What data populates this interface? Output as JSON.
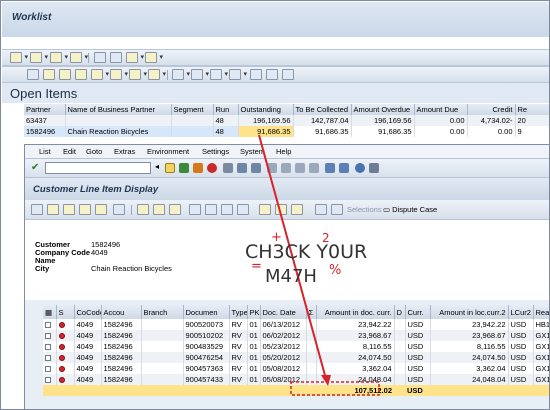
{
  "worklist": {
    "title": "Worklist"
  },
  "open_items": {
    "title": "Open Items",
    "columns": [
      "Partner",
      "Name of Business Partner",
      "Segment",
      "Run",
      "Outstanding",
      "To Be Collected",
      "Amount Overdue",
      "Amount Due",
      "Credit",
      "Re"
    ],
    "rows": [
      [
        "63437",
        "",
        "",
        "48",
        "196,169.56",
        "142,787.04",
        "196,169.56",
        "0.00",
        "4,734.02-",
        "20"
      ],
      [
        "1582496",
        "Chain Reaction Bicycles",
        "",
        "48",
        "91,686.35",
        "91,686.35",
        "91,686.35",
        "0.00",
        "0.00",
        "9"
      ]
    ]
  },
  "menu": {
    "items": [
      "List",
      "Edit",
      "Goto",
      "Extras",
      "Environment",
      "Settings",
      "System",
      "Help"
    ]
  },
  "cld": {
    "title": "Customer Line Item Display",
    "selections_label": "Selections",
    "dispute_label": "Dispute Case"
  },
  "info": {
    "customer_label": "Customer",
    "customer_value": "1582496",
    "company_label": "Company Code",
    "company_value": "4049",
    "name_label": "Name",
    "name_value": "",
    "city_label": "City",
    "city_value": "Chain Reaction Bicycles"
  },
  "grid": {
    "columns": [
      "S",
      "CoCode",
      "Accou",
      "Branch",
      "Documen",
      "Type",
      "PK",
      "Doc. Date",
      "Σ",
      "Amount in doc. curr.",
      "D",
      "Curr.",
      "Amount in loc.curr.2",
      "LCur2",
      "Reason co"
    ],
    "rows": [
      [
        "4049",
        "1582496",
        "",
        "900520073",
        "RV",
        "01",
        "06/13/2012",
        "23,942.22",
        "USD",
        "23,942.22",
        "USD",
        "HB1"
      ],
      [
        "4049",
        "1582496",
        "",
        "900510202",
        "RV",
        "01",
        "06/02/2012",
        "23,968.67",
        "USD",
        "23,968.67",
        "USD",
        "GX1"
      ],
      [
        "4049",
        "1582496",
        "",
        "900483529",
        "RV",
        "01",
        "05/23/2012",
        "8,116.55",
        "USD",
        "8,116.55",
        "USD",
        "GX1"
      ],
      [
        "4049",
        "1582496",
        "",
        "900476254",
        "RV",
        "01",
        "05/20/2012",
        "24,074.50",
        "USD",
        "24,074.50",
        "USD",
        "GX1"
      ],
      [
        "4049",
        "1582496",
        "",
        "900457363",
        "RV",
        "01",
        "05/08/2012",
        "3,362.04",
        "USD",
        "3,362.04",
        "USD",
        "GX1"
      ],
      [
        "4049",
        "1582496",
        "",
        "900457433",
        "RV",
        "01",
        "05/08/2012",
        "24,048.04",
        "USD",
        "24,048.04",
        "USD",
        "GX1"
      ]
    ],
    "total": {
      "amount": "107,512.02",
      "currency": "USD"
    }
  },
  "watermark": {
    "line1": "CH3CK Y0UR",
    "line2": "M47H",
    "marks": [
      "+",
      "2",
      "=",
      "%"
    ]
  },
  "colors": {
    "accent": "#d8232a",
    "highlight": "#ffe38a",
    "header": "#cfd9e6"
  }
}
